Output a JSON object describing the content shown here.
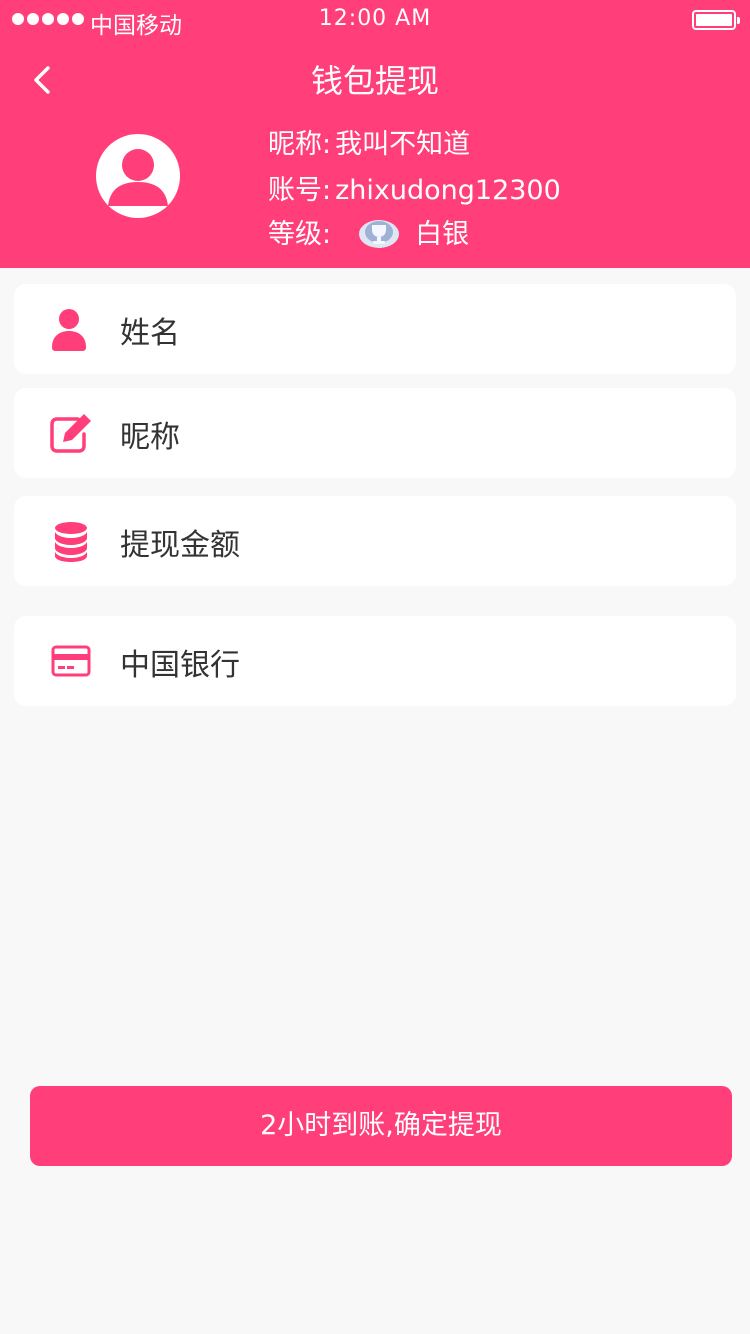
{
  "status_bar": {
    "carrier": "中国移动",
    "time": "12:00 AM"
  },
  "header": {
    "title": "钱包提现",
    "nickname_label": "昵称:",
    "nickname_value": "我叫不知道",
    "account_label": "账号:",
    "account_value": "zhixudong12300",
    "level_label": "等级:",
    "level_value": "白银"
  },
  "form": {
    "items": [
      {
        "label": "姓名",
        "icon": "user-icon"
      },
      {
        "label": "昵称",
        "icon": "edit-icon"
      },
      {
        "label": "提现金额",
        "icon": "coin-stack-icon"
      },
      {
        "label": "中国银行",
        "icon": "bank-card-icon"
      }
    ]
  },
  "submit_label": "2小时到账,确定提现",
  "colors": {
    "accent": "#ff3e7a",
    "background": "#f8f8f8",
    "text": "#333333"
  }
}
